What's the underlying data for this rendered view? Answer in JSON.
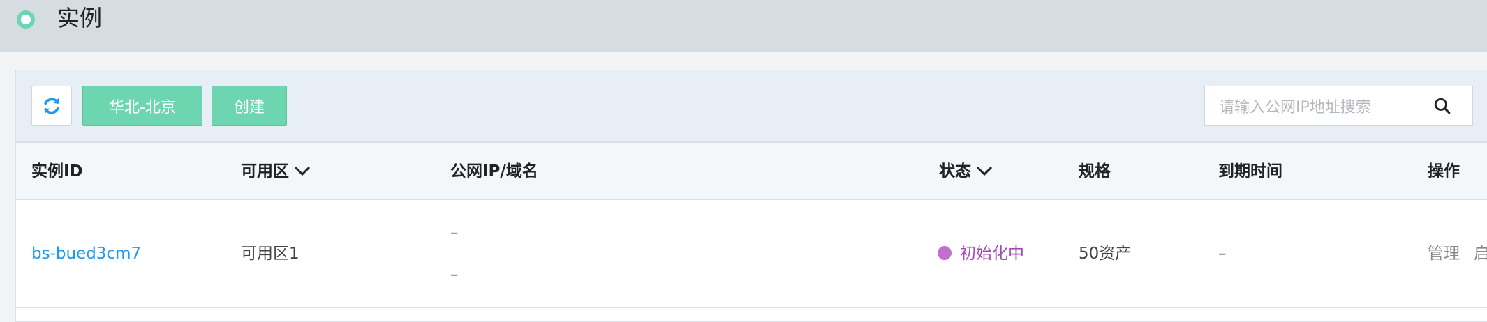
{
  "header": {
    "title": "实例"
  },
  "toolbar": {
    "refresh_icon": "refresh-icon",
    "region_label": "华北-北京",
    "create_label": "创建",
    "search_placeholder": "请输入公网IP地址搜索",
    "search_icon": "search-icon"
  },
  "table": {
    "columns": [
      "实例ID",
      "可用区",
      "公网IP/域名",
      "状态",
      "规格",
      "到期时间",
      "操作"
    ],
    "rows": [
      {
        "id": "bs-bued3cm7",
        "zone": "可用区1",
        "ip_line1": "–",
        "ip_line2": "–",
        "status": "初始化中",
        "spec": "50资产",
        "expire": "–",
        "op_manage": "管理",
        "op_next": "启"
      }
    ]
  },
  "colors": {
    "accent_green": "#6dd6b0",
    "link_blue": "#1e9bf0",
    "status_purple": "#c26fcf"
  }
}
